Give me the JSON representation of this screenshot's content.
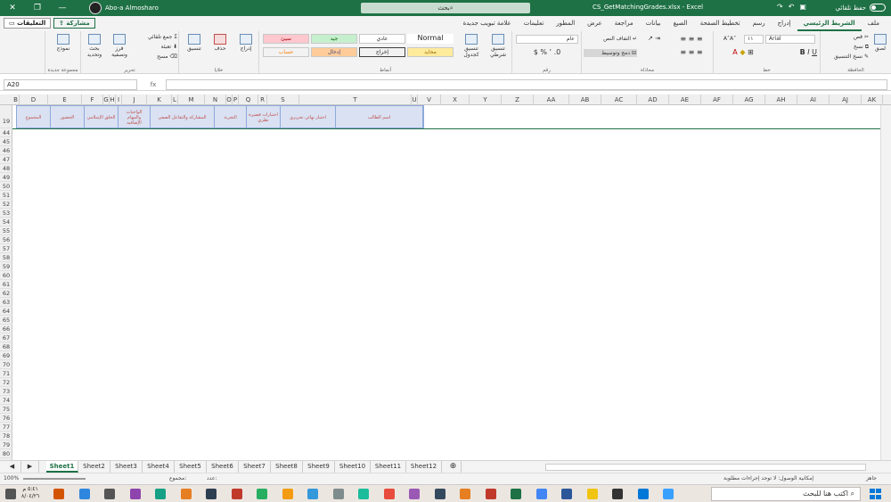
{
  "titlebar": {
    "user": "Abo-a Almosharo",
    "search": "بحث",
    "doc": "CS_GetMatchingGrades.xlsx - Excel",
    "autosave": "حفظ تلقائي"
  },
  "tabs": [
    "ملف",
    "الشريط الرئيسي",
    "إدراج",
    "رسم",
    "تخطيط الصفحة",
    "الصيغ",
    "بيانات",
    "مراجعة",
    "عرض",
    "المطور",
    "تعليمات",
    "علامة تبويب جديدة"
  ],
  "share": "مشاركة",
  "comments": "التعليقات",
  "ribbon": {
    "clipboard": {
      "label": "الحافظة",
      "paste": "لصق",
      "cut": "قص",
      "copy": "نسخ",
      "format_painter": "نسخ التنسيق"
    },
    "font": {
      "label": "خط",
      "name": "Arial",
      "size": "١١"
    },
    "alignment": {
      "label": "محاذاة",
      "wrap": "التفاف النص",
      "merge": "دمج وتوسيط"
    },
    "number": {
      "label": "رقم",
      "format": "عام"
    },
    "styles": {
      "label": "أنماط",
      "conditional": "تنسيق شرطي",
      "as_table": "تنسيق كجدول",
      "normal": "Normal",
      "normal_ar": "عادي",
      "good": "جيد",
      "bad": "سيئ",
      "output": "إخراج",
      "input": "إدخال",
      "calc": "حساب",
      "neutral": "محايد"
    },
    "cells": {
      "label": "خلايا",
      "insert": "إدراج",
      "delete": "حذف",
      "format": "تنسيق"
    },
    "editing": {
      "label": "تحرير",
      "autosum": "جمع تلقائي",
      "fill": "تعبئة",
      "clear": "مسح",
      "sort": "فرز وتصفية",
      "find": "بحث وتحديد"
    },
    "newgroup": {
      "label": "مجموعة جديدة",
      "form": "نموذج"
    }
  },
  "namebox": "A20",
  "fx": "fx",
  "columns": [
    "B",
    "D",
    "E",
    "F",
    "G",
    "H",
    "I",
    "J",
    "K",
    "L",
    "M",
    "N",
    "O",
    "P",
    "Q",
    "R",
    "S",
    "T",
    "U",
    "V",
    "X",
    "Y",
    "Z",
    "AA",
    "AB",
    "AC",
    "AD",
    "AE",
    "AF",
    "AG",
    "AH",
    "AI",
    "AJ",
    "AK"
  ],
  "rows": [
    "19",
    "44",
    "45",
    "46",
    "47",
    "48",
    "49",
    "50",
    "51",
    "52",
    "53",
    "54",
    "55",
    "56",
    "57",
    "58",
    "59",
    "60",
    "61",
    "62",
    "63",
    "64",
    "65",
    "66",
    "67",
    "68",
    "69",
    "70",
    "71",
    "72",
    "73",
    "74",
    "75",
    "76",
    "77",
    "78",
    "79",
    "80"
  ],
  "header_cells": [
    "المجموع",
    "الحضور",
    "الخلق الإسلامي",
    "الواجبات والمهام الإضافية",
    "المشاركة والتفاعل الصفي",
    "التجربة",
    "اختبارات قصيرة نظري",
    "اختبار نهائي تحريري",
    "اسم الطالب"
  ],
  "sheets": [
    "Sheet1",
    "Sheet2",
    "Sheet3",
    "Sheet4",
    "Sheet5",
    "Sheet6",
    "Sheet7",
    "Sheet8",
    "Sheet9",
    "Sheet10",
    "Sheet11",
    "Sheet12"
  ],
  "status": {
    "ready": "جاهز",
    "accessibility": "إمكانية الوصول: لا توجد إجراءات مطلوبة",
    "zoom": "100%",
    "count": "عدد:",
    "sum": "مجموع:"
  },
  "clock": {
    "time": "٥:٤١ م",
    "date": "٨/٠٤/٢٦"
  },
  "taskbar": {
    "search": "اكتب هنا للبحث"
  }
}
